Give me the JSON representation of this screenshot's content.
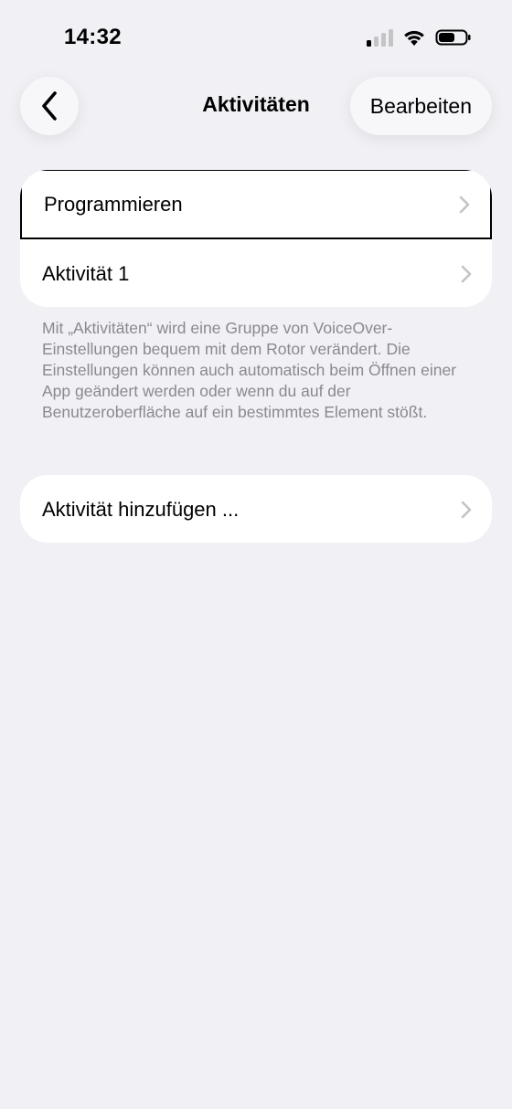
{
  "status_bar": {
    "time": "14:32",
    "signal_icon": "cellular-signal-icon",
    "wifi_icon": "wifi-icon",
    "battery_icon": "battery-icon"
  },
  "nav": {
    "back_icon": "chevron-left-icon",
    "title": "Aktivitäten",
    "edit_label": "Bearbeiten"
  },
  "list": {
    "items": [
      {
        "label": "Programmieren"
      },
      {
        "label": "Aktivität 1"
      }
    ],
    "footer": "Mit „Aktivitäten“ wird eine Gruppe von VoiceOver-Einstellungen bequem mit dem Rotor verändert. Die Einstellungen können auch automatisch beim Öffnen einer App geändert werden oder wenn du auf der Benutzeroberfläche auf ein bestimmtes Element stößt."
  },
  "add_group": {
    "label": "Aktivität hinzufügen ..."
  },
  "colors": {
    "background": "#f0f0f5",
    "card": "#ffffff",
    "secondary_text": "#8a8a8e",
    "chevron": "#c4c4c7"
  }
}
